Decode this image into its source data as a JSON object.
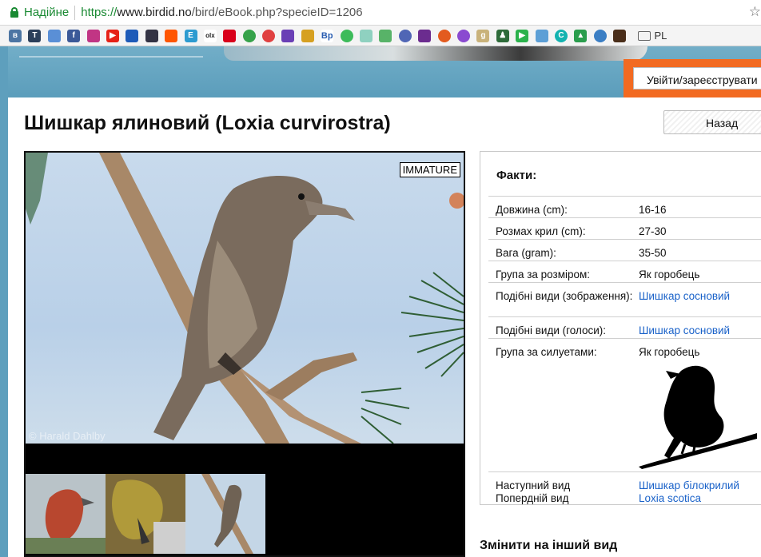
{
  "browser": {
    "secure_label": "Надійне",
    "url_scheme": "https://",
    "url_host": "www.birdid.no",
    "url_path": "/bird/eBook.php?specieID=1206",
    "bookmark_folder": "PL"
  },
  "header": {
    "login_label": "Увійти/зареєструвати"
  },
  "page": {
    "title": "Шишкар ялиновий (Loxia curvirostra)",
    "back_label": "Назад"
  },
  "gallery": {
    "badge": "IMMATURE",
    "copyright": "© Harald Dahlby"
  },
  "facts": {
    "title": "Факти:",
    "rows": [
      {
        "key": "Довжина (cm):",
        "value": "16-16"
      },
      {
        "key": "Розмах крил (cm):",
        "value": "27-30"
      },
      {
        "key": "Вага (gram):",
        "value": "35-50"
      },
      {
        "key": "Група за розміром:",
        "value": "Як горобець"
      },
      {
        "key": "Подібні види (зображення):",
        "value": "Шишкар сосновий"
      },
      {
        "key": "Подібні види (голоси):",
        "value": "Шишкар сосновий"
      },
      {
        "key": "Група за силуетами:",
        "value": "Як горобець"
      }
    ],
    "next_label": "Наступний вид",
    "next_value": "Шишкар білокрилий",
    "prev_label": "Попердній вид",
    "prev_value": "Loxia scotica"
  },
  "change_species": "Змінити на інший вид",
  "colors": {
    "accent_orange": "#f26a21",
    "link_blue": "#1a62c9",
    "banner_blue": "#5e9fbd",
    "secure_green": "#1a8a33"
  }
}
